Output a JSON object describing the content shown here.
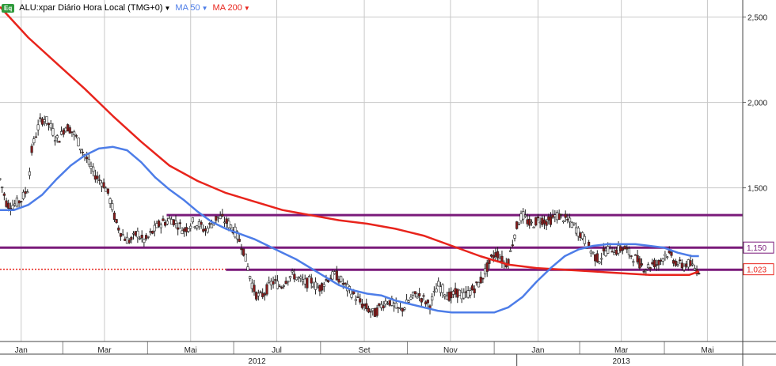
{
  "toolbar": {
    "badge": "Eq",
    "symbol_label": "ALU:xpar Diário Hora Local (TMG+0)",
    "ma50_label": "MA 50",
    "ma200_label": "MA 200"
  },
  "colors": {
    "ma50": "#4d7de8",
    "ma200": "#e8241c",
    "resistance": "#7a1a7a",
    "candle_up": "#ffffff",
    "candle_down": "#8b1a1a",
    "candle_wick": "#222222",
    "grid": "#c8c8c8",
    "price_tag_purple": "#7a1a7a",
    "price_tag_red": "#e8241c"
  },
  "chart_data": {
    "type": "candlestick",
    "title": "ALU:xpar Diário Hora Local (TMG+0)",
    "y_axis": {
      "ticks": [
        "1,500",
        "2,000",
        "2,500"
      ],
      "tick_values": [
        1.5,
        2.0,
        2.5
      ],
      "range": [
        0.6,
        2.6
      ],
      "side": "right"
    },
    "x_axis": {
      "months": [
        {
          "label": "Jan",
          "day": 15
        },
        {
          "label": "Mar",
          "day": 74
        },
        {
          "label": "Mai",
          "day": 135
        },
        {
          "label": "Jul",
          "day": 196
        },
        {
          "label": "Set",
          "day": 258
        },
        {
          "label": "Nov",
          "day": 319
        },
        {
          "label": "Jan",
          "day": 381
        },
        {
          "label": "Mar",
          "day": 440
        },
        {
          "label": "Mai",
          "day": 501
        }
      ],
      "years": [
        {
          "label": "2012",
          "day": 182
        },
        {
          "label": "2013",
          "day": 440
        }
      ],
      "year_boundary_day": 366,
      "range_days": [
        0,
        526
      ]
    },
    "price_tags": [
      {
        "label": "1,150",
        "value": 1.15,
        "style": "purple"
      },
      {
        "label": "1,023",
        "value": 1.023,
        "style": "red"
      }
    ],
    "horizontal_lines": [
      {
        "value": 1.34,
        "from_day": 118,
        "to_day": 526,
        "color": "resistance"
      },
      {
        "value": 1.15,
        "from_day": 0,
        "to_day": 526,
        "color": "resistance"
      },
      {
        "value": 1.02,
        "from_day": 160,
        "to_day": 526,
        "color": "resistance"
      },
      {
        "value": 1.023,
        "from_day": 0,
        "to_day": 160,
        "color": "ma200",
        "dotted": true
      }
    ],
    "ma200": {
      "name": "MA 200",
      "points": [
        [
          0,
          2.56
        ],
        [
          20,
          2.38
        ],
        [
          40,
          2.23
        ],
        [
          60,
          2.08
        ],
        [
          80,
          1.92
        ],
        [
          100,
          1.77
        ],
        [
          120,
          1.63
        ],
        [
          140,
          1.54
        ],
        [
          160,
          1.47
        ],
        [
          180,
          1.42
        ],
        [
          200,
          1.37
        ],
        [
          220,
          1.34
        ],
        [
          240,
          1.31
        ],
        [
          260,
          1.29
        ],
        [
          280,
          1.26
        ],
        [
          300,
          1.22
        ],
        [
          320,
          1.16
        ],
        [
          340,
          1.1
        ],
        [
          360,
          1.05
        ],
        [
          380,
          1.03
        ],
        [
          400,
          1.02
        ],
        [
          420,
          1.01
        ],
        [
          440,
          1.0
        ],
        [
          460,
          0.99
        ],
        [
          475,
          0.99
        ],
        [
          488,
          0.99
        ],
        [
          495,
          1.01
        ]
      ]
    },
    "ma50": {
      "name": "MA 50",
      "points": [
        [
          0,
          1.37
        ],
        [
          10,
          1.37
        ],
        [
          20,
          1.4
        ],
        [
          30,
          1.46
        ],
        [
          40,
          1.55
        ],
        [
          50,
          1.63
        ],
        [
          60,
          1.69
        ],
        [
          70,
          1.73
        ],
        [
          80,
          1.74
        ],
        [
          90,
          1.72
        ],
        [
          100,
          1.65
        ],
        [
          110,
          1.56
        ],
        [
          120,
          1.49
        ],
        [
          130,
          1.43
        ],
        [
          140,
          1.36
        ],
        [
          150,
          1.3
        ],
        [
          160,
          1.26
        ],
        [
          170,
          1.23
        ],
        [
          180,
          1.2
        ],
        [
          190,
          1.16
        ],
        [
          200,
          1.12
        ],
        [
          210,
          1.08
        ],
        [
          220,
          1.03
        ],
        [
          230,
          0.98
        ],
        [
          240,
          0.93
        ],
        [
          250,
          0.9
        ],
        [
          260,
          0.88
        ],
        [
          270,
          0.87
        ],
        [
          280,
          0.84
        ],
        [
          290,
          0.82
        ],
        [
          300,
          0.8
        ],
        [
          310,
          0.78
        ],
        [
          320,
          0.77
        ],
        [
          330,
          0.77
        ],
        [
          340,
          0.77
        ],
        [
          350,
          0.77
        ],
        [
          360,
          0.8
        ],
        [
          370,
          0.86
        ],
        [
          380,
          0.95
        ],
        [
          390,
          1.03
        ],
        [
          400,
          1.1
        ],
        [
          410,
          1.14
        ],
        [
          420,
          1.16
        ],
        [
          430,
          1.17
        ],
        [
          440,
          1.17
        ],
        [
          450,
          1.17
        ],
        [
          460,
          1.16
        ],
        [
          470,
          1.15
        ],
        [
          480,
          1.12
        ],
        [
          490,
          1.1
        ],
        [
          495,
          1.1
        ]
      ]
    },
    "close": {
      "name": "Close",
      "points": [
        [
          0,
          1.55
        ],
        [
          5,
          1.4
        ],
        [
          10,
          1.4
        ],
        [
          15,
          1.43
        ],
        [
          20,
          1.5
        ],
        [
          22,
          1.7
        ],
        [
          25,
          1.8
        ],
        [
          28,
          1.88
        ],
        [
          31,
          1.91
        ],
        [
          34,
          1.88
        ],
        [
          37,
          1.84
        ],
        [
          40,
          1.78
        ],
        [
          43,
          1.8
        ],
        [
          46,
          1.86
        ],
        [
          49,
          1.85
        ],
        [
          52,
          1.82
        ],
        [
          55,
          1.78
        ],
        [
          58,
          1.72
        ],
        [
          61,
          1.68
        ],
        [
          64,
          1.62
        ],
        [
          67,
          1.58
        ],
        [
          70,
          1.55
        ],
        [
          73,
          1.53
        ],
        [
          76,
          1.48
        ],
        [
          79,
          1.4
        ],
        [
          82,
          1.3
        ],
        [
          85,
          1.25
        ],
        [
          88,
          1.21
        ],
        [
          91,
          1.19
        ],
        [
          94,
          1.2
        ],
        [
          97,
          1.24
        ],
        [
          100,
          1.2
        ],
        [
          103,
          1.19
        ],
        [
          106,
          1.22
        ],
        [
          109,
          1.25
        ],
        [
          112,
          1.28
        ],
        [
          115,
          1.3
        ],
        [
          118,
          1.3
        ],
        [
          121,
          1.32
        ],
        [
          124,
          1.3
        ],
        [
          127,
          1.28
        ],
        [
          130,
          1.25
        ],
        [
          133,
          1.27
        ],
        [
          136,
          1.3
        ],
        [
          139,
          1.29
        ],
        [
          142,
          1.28
        ],
        [
          145,
          1.25
        ],
        [
          148,
          1.27
        ],
        [
          151,
          1.3
        ],
        [
          154,
          1.33
        ],
        [
          157,
          1.32
        ],
        [
          160,
          1.3
        ],
        [
          163,
          1.28
        ],
        [
          166,
          1.25
        ],
        [
          169,
          1.2
        ],
        [
          172,
          1.15
        ],
        [
          175,
          1.05
        ],
        [
          178,
          0.95
        ],
        [
          181,
          0.88
        ],
        [
          184,
          0.86
        ],
        [
          187,
          0.88
        ],
        [
          190,
          0.92
        ],
        [
          193,
          0.95
        ],
        [
          196,
          0.94
        ],
        [
          199,
          0.92
        ],
        [
          202,
          0.96
        ],
        [
          205,
          0.98
        ],
        [
          208,
          0.99
        ],
        [
          211,
          0.97
        ],
        [
          214,
          0.95
        ],
        [
          217,
          0.94
        ],
        [
          220,
          0.96
        ],
        [
          223,
          0.93
        ],
        [
          226,
          0.91
        ],
        [
          229,
          0.94
        ],
        [
          232,
          0.97
        ],
        [
          235,
          0.98
        ],
        [
          238,
          0.99
        ],
        [
          241,
          0.96
        ],
        [
          244,
          0.93
        ],
        [
          247,
          0.9
        ],
        [
          250,
          0.88
        ],
        [
          253,
          0.85
        ],
        [
          256,
          0.82
        ],
        [
          259,
          0.8
        ],
        [
          262,
          0.78
        ],
        [
          265,
          0.76
        ],
        [
          268,
          0.79
        ],
        [
          271,
          0.82
        ],
        [
          274,
          0.84
        ],
        [
          277,
          0.83
        ],
        [
          280,
          0.8
        ],
        [
          283,
          0.78
        ],
        [
          286,
          0.8
        ],
        [
          289,
          0.83
        ],
        [
          292,
          0.86
        ],
        [
          295,
          0.88
        ],
        [
          298,
          0.86
        ],
        [
          301,
          0.84
        ],
        [
          304,
          0.81
        ],
        [
          307,
          0.86
        ],
        [
          310,
          0.93
        ],
        [
          313,
          0.91
        ],
        [
          316,
          0.88
        ],
        [
          319,
          0.86
        ],
        [
          322,
          0.88
        ],
        [
          325,
          0.89
        ],
        [
          328,
          0.86
        ],
        [
          331,
          0.88
        ],
        [
          334,
          0.9
        ],
        [
          337,
          0.92
        ],
        [
          340,
          0.95
        ],
        [
          343,
          1.0
        ],
        [
          346,
          1.05
        ],
        [
          349,
          1.1
        ],
        [
          352,
          1.12
        ],
        [
          355,
          1.08
        ],
        [
          358,
          1.05
        ],
        [
          361,
          1.1
        ],
        [
          364,
          1.22
        ],
        [
          367,
          1.3
        ],
        [
          370,
          1.34
        ],
        [
          373,
          1.31
        ],
        [
          376,
          1.28
        ],
        [
          379,
          1.3
        ],
        [
          382,
          1.32
        ],
        [
          385,
          1.31
        ],
        [
          388,
          1.3
        ],
        [
          391,
          1.32
        ],
        [
          394,
          1.34
        ],
        [
          397,
          1.33
        ],
        [
          400,
          1.32
        ],
        [
          403,
          1.3
        ],
        [
          406,
          1.28
        ],
        [
          409,
          1.25
        ],
        [
          412,
          1.22
        ],
        [
          415,
          1.18
        ],
        [
          418,
          1.14
        ],
        [
          421,
          1.1
        ],
        [
          424,
          1.08
        ],
        [
          427,
          1.11
        ],
        [
          430,
          1.14
        ],
        [
          433,
          1.15
        ],
        [
          436,
          1.13
        ],
        [
          439,
          1.14
        ],
        [
          442,
          1.15
        ],
        [
          445,
          1.12
        ],
        [
          448,
          1.1
        ],
        [
          451,
          1.08
        ],
        [
          454,
          1.05
        ],
        [
          457,
          1.03
        ],
        [
          460,
          1.04
        ],
        [
          463,
          1.06
        ],
        [
          466,
          1.05
        ],
        [
          469,
          1.09
        ],
        [
          472,
          1.12
        ],
        [
          475,
          1.1
        ],
        [
          478,
          1.07
        ],
        [
          481,
          1.05
        ],
        [
          484,
          1.04
        ],
        [
          487,
          1.06
        ],
        [
          490,
          1.04
        ],
        [
          493,
          1.02
        ],
        [
          495,
          1.02
        ]
      ]
    }
  }
}
